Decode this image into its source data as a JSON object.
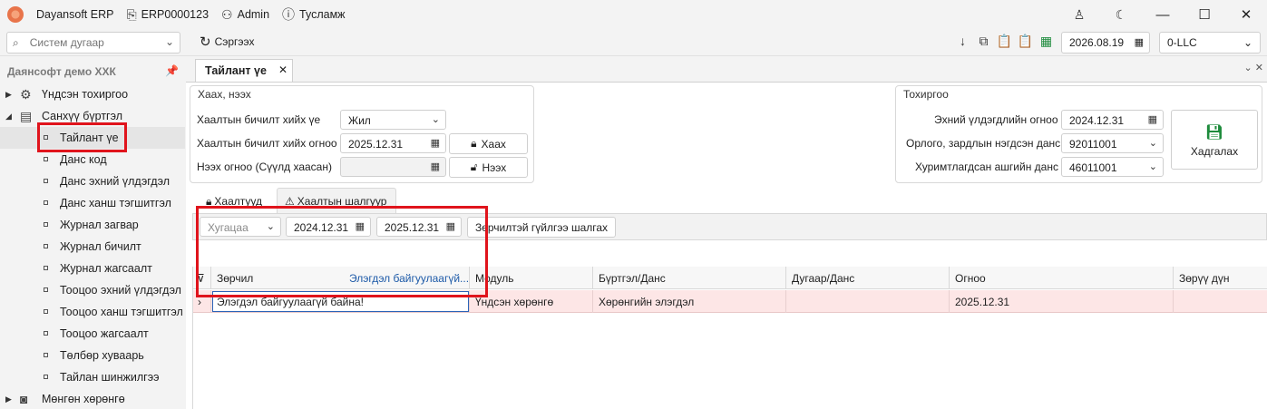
{
  "titlebar": {
    "app_name": "Dayansoft ERP",
    "erp_id": "ERP0000123",
    "user": "Admin",
    "help": "Тусламж"
  },
  "toolbar": {
    "search_placeholder": "Систем дугаар",
    "refresh_label": "Сэргээх",
    "date": "2026.08.19",
    "company": "0-LLC"
  },
  "sidebar": {
    "title": "Даянсофт демо ХХК",
    "items": [
      {
        "label": "Үндсэн тохиргоо"
      },
      {
        "label": "Санхүү бүртгэл"
      },
      {
        "label": "Тайлант үе"
      },
      {
        "label": "Данс код"
      },
      {
        "label": "Данс эхний үлдэгдэл"
      },
      {
        "label": "Данс ханш тэгшитгэл"
      },
      {
        "label": "Журнал загвар"
      },
      {
        "label": "Журнал бичилт"
      },
      {
        "label": "Журнал жагсаалт"
      },
      {
        "label": "Тооцоо эхний үлдэгдэл"
      },
      {
        "label": "Тооцоо ханш тэгшитгэл"
      },
      {
        "label": "Тооцоо жагсаалт"
      },
      {
        "label": "Төлбөр хуваарь"
      },
      {
        "label": "Тайлан шинжилгээ"
      },
      {
        "label": "Мөнгөн хөрөнгө"
      }
    ]
  },
  "doc_tab": {
    "title": "Тайлант үе"
  },
  "close_group": {
    "title": "Хаах, нээх",
    "row1_label": "Хаалтын бичилт хийх үе",
    "row1_value": "Жил",
    "row2_label": "Хаалтын бичилт хийх огноо",
    "row2_value": "2025.12.31",
    "row2_button": "Хаах",
    "row3_label": "Нээх огноо (Сүүлд хаасан)",
    "row3_value": "",
    "row3_button": "Нээх"
  },
  "settings_group": {
    "title": "Тохиргоо",
    "row1_label": "Эхний үлдэгдлийн огноо",
    "row1_value": "2024.12.31",
    "row2_label": "Орлого, зардлын нэгдсэн данс",
    "row2_value": "92011001",
    "row3_label": "Хуримтлагдсан ашгийн данс",
    "row3_value": "46011001",
    "save_label": "Хадгалах"
  },
  "inner_tabs": [
    {
      "label": "Хаалтууд"
    },
    {
      "label": "Хаалтын шалгуур"
    }
  ],
  "filter": {
    "period_placeholder": "Хугацаа",
    "date_from": "2024.12.31",
    "date_to": "2025.12.31",
    "check_button": "Зөрчилтэй гүйлгээ шалгах"
  },
  "grid": {
    "headers": [
      "Зөрчил",
      "Элэгдэл байгуулаагүй...",
      "Модуль",
      "Бүртгэл/Данс",
      "Дугаар/Данс",
      "Огноо",
      "Зөрүү дүн"
    ],
    "row": {
      "violation": "Элэгдэл байгуулаагүй байна!",
      "module": "Үндсэн хөрөнгө",
      "register": "Хөрөнгийн элэгдэл",
      "number": "",
      "date": "2025.12.31",
      "diff": ""
    }
  }
}
